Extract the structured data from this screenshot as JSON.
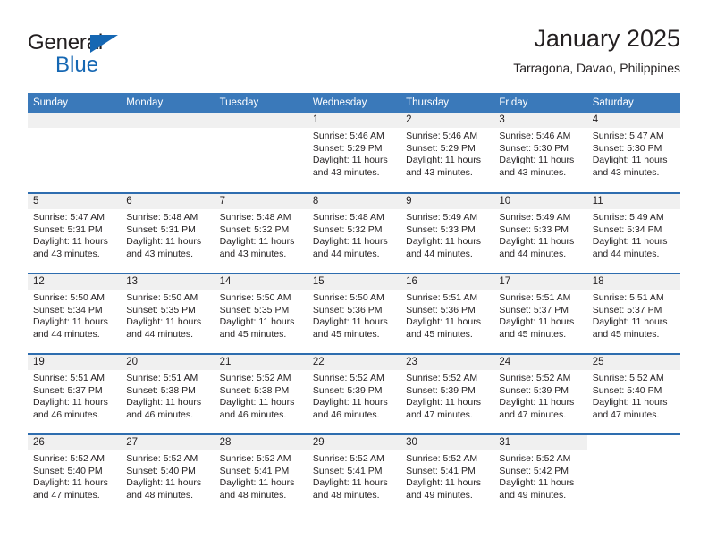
{
  "brand": {
    "name_part1": "General",
    "name_part2": "Blue",
    "triangle_color": "#1567b3"
  },
  "header": {
    "title": "January 2025",
    "subtitle": "Tarragona, Davao, Philippines",
    "header_bg_color": "#3a79ba",
    "row_divider_color": "#2e6daf",
    "daynum_band_color": "#f0f0f0"
  },
  "weekday_headers": [
    "Sunday",
    "Monday",
    "Tuesday",
    "Wednesday",
    "Thursday",
    "Friday",
    "Saturday"
  ],
  "labels": {
    "sunrise_prefix": "Sunrise:",
    "sunset_prefix": "Sunset:",
    "daylight_prefix": "Daylight:"
  },
  "weeks": [
    [
      {
        "day": "",
        "empty": true
      },
      {
        "day": "",
        "empty": true
      },
      {
        "day": "",
        "empty": true
      },
      {
        "day": "1",
        "sunrise": "Sunrise: 5:46 AM",
        "sunset": "Sunset: 5:29 PM",
        "daylight_line1": "Daylight: 11 hours",
        "daylight_line2": "and 43 minutes."
      },
      {
        "day": "2",
        "sunrise": "Sunrise: 5:46 AM",
        "sunset": "Sunset: 5:29 PM",
        "daylight_line1": "Daylight: 11 hours",
        "daylight_line2": "and 43 minutes."
      },
      {
        "day": "3",
        "sunrise": "Sunrise: 5:46 AM",
        "sunset": "Sunset: 5:30 PM",
        "daylight_line1": "Daylight: 11 hours",
        "daylight_line2": "and 43 minutes."
      },
      {
        "day": "4",
        "sunrise": "Sunrise: 5:47 AM",
        "sunset": "Sunset: 5:30 PM",
        "daylight_line1": "Daylight: 11 hours",
        "daylight_line2": "and 43 minutes."
      }
    ],
    [
      {
        "day": "5",
        "sunrise": "Sunrise: 5:47 AM",
        "sunset": "Sunset: 5:31 PM",
        "daylight_line1": "Daylight: 11 hours",
        "daylight_line2": "and 43 minutes."
      },
      {
        "day": "6",
        "sunrise": "Sunrise: 5:48 AM",
        "sunset": "Sunset: 5:31 PM",
        "daylight_line1": "Daylight: 11 hours",
        "daylight_line2": "and 43 minutes."
      },
      {
        "day": "7",
        "sunrise": "Sunrise: 5:48 AM",
        "sunset": "Sunset: 5:32 PM",
        "daylight_line1": "Daylight: 11 hours",
        "daylight_line2": "and 43 minutes."
      },
      {
        "day": "8",
        "sunrise": "Sunrise: 5:48 AM",
        "sunset": "Sunset: 5:32 PM",
        "daylight_line1": "Daylight: 11 hours",
        "daylight_line2": "and 44 minutes."
      },
      {
        "day": "9",
        "sunrise": "Sunrise: 5:49 AM",
        "sunset": "Sunset: 5:33 PM",
        "daylight_line1": "Daylight: 11 hours",
        "daylight_line2": "and 44 minutes."
      },
      {
        "day": "10",
        "sunrise": "Sunrise: 5:49 AM",
        "sunset": "Sunset: 5:33 PM",
        "daylight_line1": "Daylight: 11 hours",
        "daylight_line2": "and 44 minutes."
      },
      {
        "day": "11",
        "sunrise": "Sunrise: 5:49 AM",
        "sunset": "Sunset: 5:34 PM",
        "daylight_line1": "Daylight: 11 hours",
        "daylight_line2": "and 44 minutes."
      }
    ],
    [
      {
        "day": "12",
        "sunrise": "Sunrise: 5:50 AM",
        "sunset": "Sunset: 5:34 PM",
        "daylight_line1": "Daylight: 11 hours",
        "daylight_line2": "and 44 minutes."
      },
      {
        "day": "13",
        "sunrise": "Sunrise: 5:50 AM",
        "sunset": "Sunset: 5:35 PM",
        "daylight_line1": "Daylight: 11 hours",
        "daylight_line2": "and 44 minutes."
      },
      {
        "day": "14",
        "sunrise": "Sunrise: 5:50 AM",
        "sunset": "Sunset: 5:35 PM",
        "daylight_line1": "Daylight: 11 hours",
        "daylight_line2": "and 45 minutes."
      },
      {
        "day": "15",
        "sunrise": "Sunrise: 5:50 AM",
        "sunset": "Sunset: 5:36 PM",
        "daylight_line1": "Daylight: 11 hours",
        "daylight_line2": "and 45 minutes."
      },
      {
        "day": "16",
        "sunrise": "Sunrise: 5:51 AM",
        "sunset": "Sunset: 5:36 PM",
        "daylight_line1": "Daylight: 11 hours",
        "daylight_line2": "and 45 minutes."
      },
      {
        "day": "17",
        "sunrise": "Sunrise: 5:51 AM",
        "sunset": "Sunset: 5:37 PM",
        "daylight_line1": "Daylight: 11 hours",
        "daylight_line2": "and 45 minutes."
      },
      {
        "day": "18",
        "sunrise": "Sunrise: 5:51 AM",
        "sunset": "Sunset: 5:37 PM",
        "daylight_line1": "Daylight: 11 hours",
        "daylight_line2": "and 45 minutes."
      }
    ],
    [
      {
        "day": "19",
        "sunrise": "Sunrise: 5:51 AM",
        "sunset": "Sunset: 5:37 PM",
        "daylight_line1": "Daylight: 11 hours",
        "daylight_line2": "and 46 minutes."
      },
      {
        "day": "20",
        "sunrise": "Sunrise: 5:51 AM",
        "sunset": "Sunset: 5:38 PM",
        "daylight_line1": "Daylight: 11 hours",
        "daylight_line2": "and 46 minutes."
      },
      {
        "day": "21",
        "sunrise": "Sunrise: 5:52 AM",
        "sunset": "Sunset: 5:38 PM",
        "daylight_line1": "Daylight: 11 hours",
        "daylight_line2": "and 46 minutes."
      },
      {
        "day": "22",
        "sunrise": "Sunrise: 5:52 AM",
        "sunset": "Sunset: 5:39 PM",
        "daylight_line1": "Daylight: 11 hours",
        "daylight_line2": "and 46 minutes."
      },
      {
        "day": "23",
        "sunrise": "Sunrise: 5:52 AM",
        "sunset": "Sunset: 5:39 PM",
        "daylight_line1": "Daylight: 11 hours",
        "daylight_line2": "and 47 minutes."
      },
      {
        "day": "24",
        "sunrise": "Sunrise: 5:52 AM",
        "sunset": "Sunset: 5:39 PM",
        "daylight_line1": "Daylight: 11 hours",
        "daylight_line2": "and 47 minutes."
      },
      {
        "day": "25",
        "sunrise": "Sunrise: 5:52 AM",
        "sunset": "Sunset: 5:40 PM",
        "daylight_line1": "Daylight: 11 hours",
        "daylight_line2": "and 47 minutes."
      }
    ],
    [
      {
        "day": "26",
        "sunrise": "Sunrise: 5:52 AM",
        "sunset": "Sunset: 5:40 PM",
        "daylight_line1": "Daylight: 11 hours",
        "daylight_line2": "and 47 minutes."
      },
      {
        "day": "27",
        "sunrise": "Sunrise: 5:52 AM",
        "sunset": "Sunset: 5:40 PM",
        "daylight_line1": "Daylight: 11 hours",
        "daylight_line2": "and 48 minutes."
      },
      {
        "day": "28",
        "sunrise": "Sunrise: 5:52 AM",
        "sunset": "Sunset: 5:41 PM",
        "daylight_line1": "Daylight: 11 hours",
        "daylight_line2": "and 48 minutes."
      },
      {
        "day": "29",
        "sunrise": "Sunrise: 5:52 AM",
        "sunset": "Sunset: 5:41 PM",
        "daylight_line1": "Daylight: 11 hours",
        "daylight_line2": "and 48 minutes."
      },
      {
        "day": "30",
        "sunrise": "Sunrise: 5:52 AM",
        "sunset": "Sunset: 5:41 PM",
        "daylight_line1": "Daylight: 11 hours",
        "daylight_line2": "and 49 minutes."
      },
      {
        "day": "31",
        "sunrise": "Sunrise: 5:52 AM",
        "sunset": "Sunset: 5:42 PM",
        "daylight_line1": "Daylight: 11 hours",
        "daylight_line2": "and 49 minutes."
      },
      {
        "day": "",
        "empty": true,
        "no_band": true
      }
    ]
  ]
}
